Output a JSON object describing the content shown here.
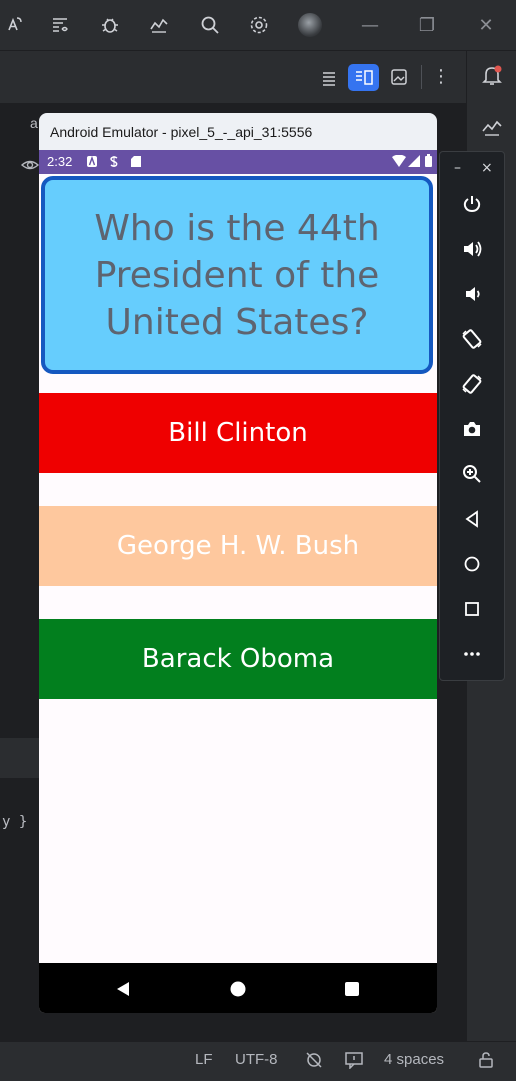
{
  "ide": {
    "window_controls": {
      "minimize": "—",
      "restore": "❐",
      "close": "✕"
    },
    "left_tab_letter": "a",
    "code_fragment": "y }",
    "status_bar": {
      "line_sep": "LF",
      "encoding": "UTF-8",
      "indent": "4 spaces"
    }
  },
  "emulator": {
    "title": "Android Emulator - pixel_5_-_api_31:5556",
    "panel": {
      "minimize": "–",
      "close": "×"
    }
  },
  "device": {
    "status_time": "2:32",
    "question": "Who is the 44th President of the United States?",
    "answers": [
      {
        "label": "Bill Clinton",
        "color": "#ef0000",
        "text_color": "#ffffff"
      },
      {
        "label": "George H. W. Bush",
        "color": "#fec89e",
        "text_color": "#ffffff"
      },
      {
        "label": "Barack Oboma",
        "color": "#027f1e",
        "text_color": "#ffffff"
      }
    ]
  },
  "colors": {
    "status_bar": "#6750a4",
    "question_bg": "#66cdfd",
    "question_border": "#1558c0",
    "accent": "#3574f0"
  }
}
